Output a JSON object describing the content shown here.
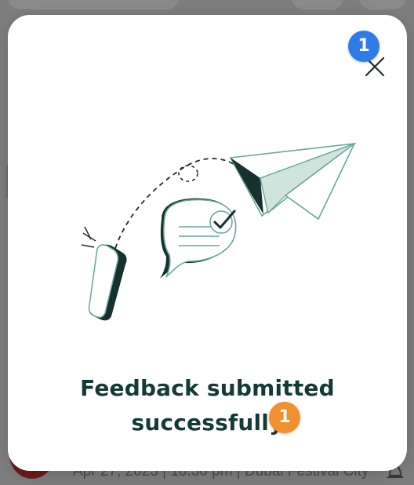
{
  "background": {
    "booking_text": "Apr 27, 2023 | 10:30 pm | Dubai Festival City",
    "bell_icon": "bell-icon"
  },
  "modal": {
    "close_icon": "close-icon",
    "illustration": "paper-plane-feedback-illustration",
    "title_line1": "Feedback submitted",
    "title_line2": "successfully"
  },
  "annotations": [
    {
      "label": "1",
      "color": "#2f7be8"
    },
    {
      "label": "1",
      "color": "#f0902f"
    }
  ],
  "colors": {
    "accent_dark": "#143a35",
    "accent_teal": "#6aa79a",
    "overlay": "#7d7d7d"
  }
}
